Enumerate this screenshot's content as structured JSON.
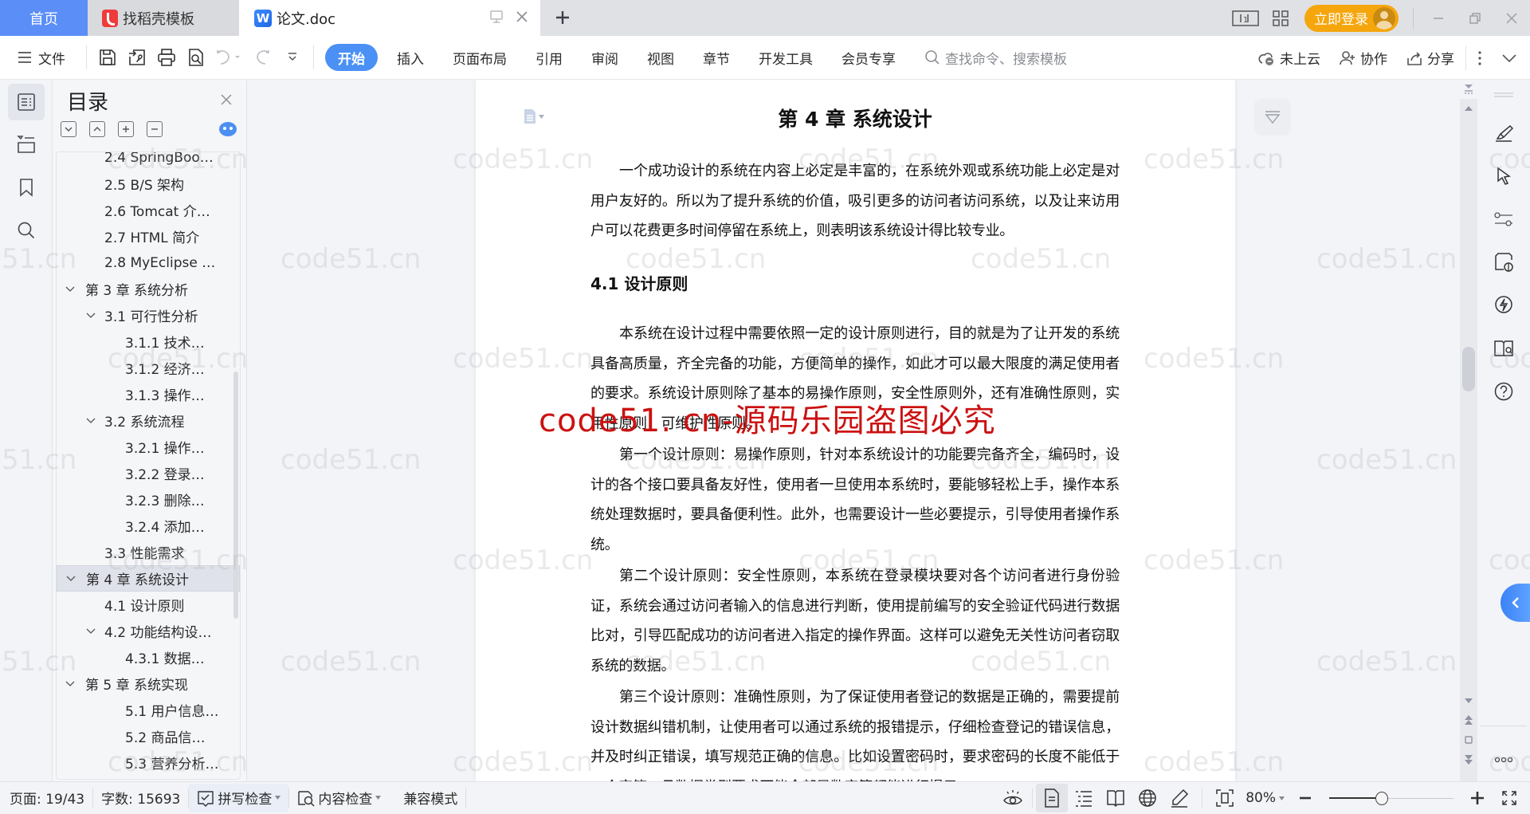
{
  "tabs": [
    {
      "label": "首页",
      "active": false
    },
    {
      "label": "找稻壳模板",
      "active": false
    },
    {
      "label": "论文.doc",
      "active": true
    }
  ],
  "titlebar": {
    "login_label": "立即登录",
    "new_tab_symbol": "+"
  },
  "toolbar": {
    "file_label": "文件",
    "menu_tabs": [
      "开始",
      "插入",
      "页面布局",
      "引用",
      "审阅",
      "视图",
      "章节",
      "开发工具",
      "会员专享"
    ],
    "active_menu": "开始",
    "search_placeholder": "查找命令、搜索模板",
    "cloud_label": "未上云",
    "collab_label": "协作",
    "share_label": "分享"
  },
  "toc": {
    "title": "目录",
    "items": [
      {
        "level": 3,
        "text": "2.4 SpringBoo…",
        "expandable": false
      },
      {
        "level": 3,
        "text": "2.5 B/S 架构",
        "expandable": false
      },
      {
        "level": 3,
        "text": "2.6 Tomcat 介…",
        "expandable": false
      },
      {
        "level": 3,
        "text": "2.7 HTML 简介",
        "expandable": false
      },
      {
        "level": 3,
        "text": "2.8 MyEclipse …",
        "expandable": false
      },
      {
        "level": 1,
        "text": "第 3 章  系统分析",
        "expandable": true
      },
      {
        "level": 2,
        "text": "3.1  可行性分析",
        "expandable": true
      },
      {
        "level": 4,
        "text": "3.1.1  技术…",
        "expandable": false
      },
      {
        "level": 4,
        "text": "3.1.2  经济…",
        "expandable": false
      },
      {
        "level": 4,
        "text": "3.1.3  操作…",
        "expandable": false
      },
      {
        "level": 2,
        "text": "3.2  系统流程",
        "expandable": true
      },
      {
        "level": 4,
        "text": "3.2.1  操作…",
        "expandable": false
      },
      {
        "level": 4,
        "text": "3.2.2  登录…",
        "expandable": false
      },
      {
        "level": 4,
        "text": "3.2.3  删除…",
        "expandable": false
      },
      {
        "level": 4,
        "text": "3.2.4  添加…",
        "expandable": false
      },
      {
        "level": 3,
        "text": "3.3  性能需求",
        "expandable": false
      },
      {
        "level": 1,
        "text": "第 4 章  系统设计",
        "expandable": true,
        "active": true
      },
      {
        "level": 3,
        "text": "4.1  设计原则",
        "expandable": false
      },
      {
        "level": 2,
        "text": "4.2  功能结构设…",
        "expandable": true
      },
      {
        "level": 4,
        "text": "4.3.1  数据…",
        "expandable": false
      },
      {
        "level": 1,
        "text": "第 5 章  系统实现",
        "expandable": true
      },
      {
        "level": 4,
        "text": "5.1 用户信息…",
        "expandable": false
      },
      {
        "level": 4,
        "text": "5.2  商品信…",
        "expandable": false
      },
      {
        "level": 4,
        "text": "5.3 营养分析…",
        "expandable": false
      }
    ]
  },
  "document": {
    "chapter_title": "第 4 章  系统设计",
    "intro": "一个成功设计的系统在内容上必定是丰富的，在系统外观或系统功能上必定是对用户友好的。所以为了提升系统的价值，吸引更多的访问者访问系统，以及让来访用户可以花费更多时间停留在系统上，则表明该系统设计得比较专业。",
    "section_title": "4.1  设计原则",
    "section_intro": "本系统在设计过程中需要依照一定的设计原则进行，目的就是为了让开发的系统具备高质量，齐全完备的功能，方便简单的操作，如此才可以最大限度的满足使用者的要求。系统设计原则除了基本的易操作原则，安全性原则外，还有准确性原则，实用性原则，可维护性原则。",
    "principle_1": "第一个设计原则：易操作原则，针对本系统设计的功能要完备齐全，编码时，设计的各个接口要具备友好性，使用者一旦使用本系统时，要能够轻松上手，操作本系统处理数据时，要具备便利性。此外，也需要设计一些必要提示，引导使用者操作系统。",
    "principle_2": "第二个设计原则：安全性原则，本系统在登录模块要对各个访问者进行身份验证，系统会通过访问者输入的信息进行判断，使用提前编写的安全验证代码进行数据比对，引导匹配成功的访问者进入指定的操作界面。这样可以避免无关性访问者窃取系统的数据。",
    "principle_3": "第三个设计原则：准确性原则，为了保证使用者登记的数据是正确的，需要提前设计数据纠错机制，让使用者可以通过系统的报错提示，仔细检查登记的错误信息，并及时纠正错误，填写规范正确的信息。比如设置密码时，要求密码的长度不能低于一个字符，且数据类型要求不能全部是数字等都能进行提示。",
    "red_watermark": "code51. cn-源码乐园盗图必究",
    "tile_watermark": "code51.cn"
  },
  "statusbar": {
    "page": "页面: 19/43",
    "word_count": "字数: 15693",
    "spell_check": "拼写检查",
    "content_check": "内容检查",
    "compat_mode": "兼容模式",
    "zoom_level": "80%",
    "zoom_fraction": 0.42
  },
  "colors": {
    "accent": "#4a90f5",
    "home_tab": "#5b8ef7",
    "login": "#f5a60c",
    "watermark_red": "#cc1111"
  }
}
